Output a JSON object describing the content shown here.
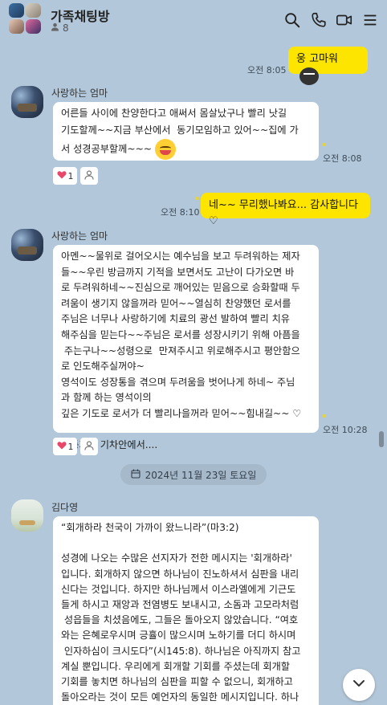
{
  "header": {
    "title": "가족채팅방",
    "member_count": "8"
  },
  "messages": [
    {
      "id": "m1",
      "from": "me",
      "text": "웅 고마워",
      "time": "오전 8:05"
    },
    {
      "id": "m2",
      "from": "other",
      "sender": "사랑하는 엄마",
      "text": "어른들 사이에 찬양한다고 애써서 몸살났구나 빨리 낫길\n기도할께~~지금 부산에서  동기모임하고 있어~~집에 가\n서 성경공부할께~~~",
      "time": "오전 8:08",
      "reaction_count": "1"
    },
    {
      "id": "m3",
      "from": "me",
      "text": "네~~ 무리했나봐요... 감사합니다♡",
      "time": "오전 8:10"
    },
    {
      "id": "m4",
      "from": "other",
      "sender": "사랑하는 엄마",
      "text": "아멘~~물위로 걸어오시는 예수님을 보고 두려워하는 제자\n들~~우린 방금까지 기적을 보면서도 고난이 다가오면 바\n로 두려워하네~~진심으로 깨어있는 믿음으로 승화할때 두\n려움이 생기지 않을꺼라 믿어~~열심히 찬양했던 로서를\n주님은 너무나 사랑하기에 치료의 광선 발하여 빨리 치유\n해주심을 믿는다~~주님은 로서를 성장시키기 위해 아픔을\n 주는구나~~성령으로  만져주시고 위로해주시고 평안함으\n로 인도해주실꺼야~\n영석이도 성장통을 겪으며 두려움을 벗어나게 하네~ 주님\n과 함께 하는 영석이의\n깊은 기도로 로서가 더 빨리나을꺼라 믿어~~힘내길~~ ♡\n\n상동가는 기차안에서....",
      "time": "오전 10:28",
      "reaction_count": "1"
    }
  ],
  "date_divider": "2024년 11월 23일 토요일",
  "last_message": {
    "sender": "김다영",
    "text": "“회개하라 천국이 가까이 왔느니라”(마3:2)\n\n성경에 나오는 수많은 선지자가 전한 메시지는 '회개하라'\n입니다. 회개하지 않으면 하나님이 진노하셔서 심판을 내리\n신다는 것입니다. 하지만 하나님께서 이스라엘에게 기근도\n들게 하시고 재앙과 전염병도 보내시고, 소돔과 고모라처럼\n 성읍들을 치셨음에도, 그들은 돌아오지 않았습니다. “여호\n와는 은혜로우시며 긍휼이 많으시며 노하기를 더디 하시며\n 인자하심이 크시도다”(시145:8). 하나님은 아직까지 참고\n계실 뿐입니다. 우리에게 회개할 기회를 주셨는데 회개할\n기회를 놓치면 하나님의 심판을 피할 수 없으니, 회개하고\n돌아오라는 것이 모든 예언자의 동일한 메시지입니다. 하나\n님께서는 진노하지 않으시는 것이 아니라, 참고계실 뿐입니\n다. 우리가 살아가는 모습, 오늘날 교회의 모습, 세상 돌아"
  },
  "colors": {
    "background": "#b2c7d9",
    "my_bubble": "#fee500",
    "other_bubble": "#ffffff",
    "reaction_heart": "#e8476a"
  },
  "icons": [
    "search-icon",
    "phone-icon",
    "video-call-icon",
    "menu-icon",
    "person-icon",
    "heart-icon",
    "calendar-icon",
    "chevron-down-icon"
  ]
}
